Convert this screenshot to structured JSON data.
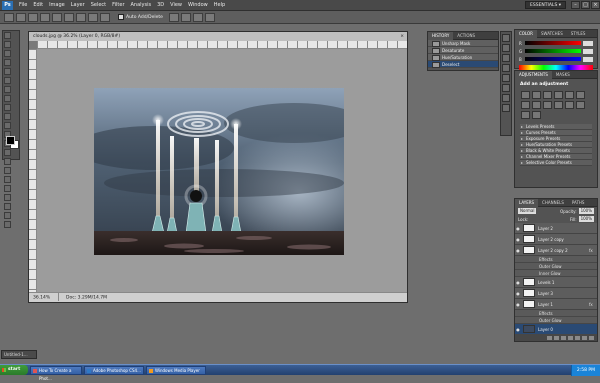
{
  "app": {
    "logo": "Ps",
    "menu": [
      "File",
      "Edit",
      "Image",
      "Layer",
      "Select",
      "Filter",
      "Analysis",
      "3D",
      "View",
      "Window",
      "Help"
    ],
    "workspace": "ESSENTIALS ▾",
    "window_buttons": [
      "–",
      "□",
      "×"
    ]
  },
  "options_bar": {
    "auto_add_delete": "Auto Add/Delete"
  },
  "document": {
    "title": "clouds.jpg @ 36.2% (Layer 0, RGB/8#)",
    "close": "×",
    "zoom": "36.14%",
    "doc_size": "Doc: 3.29M/14.7M"
  },
  "history": {
    "tabs": [
      "History",
      "Actions"
    ],
    "items": [
      "Unsharp Mask",
      "Desaturate",
      "Hue/Saturation",
      "Deselect"
    ]
  },
  "color_panel": {
    "tabs": [
      "Color",
      "Swatches",
      "Styles"
    ],
    "channels": [
      {
        "label": "R",
        "value": ""
      },
      {
        "label": "G",
        "value": ""
      },
      {
        "label": "B",
        "value": ""
      }
    ]
  },
  "adjustments": {
    "tabs": [
      "Adjustments",
      "Masks"
    ],
    "title": "Add an adjustment",
    "presets": [
      "Levels Presets",
      "Curves Presets",
      "Exposure Presets",
      "Hue/Saturation Presets",
      "Black & White Presets",
      "Channel Mixer Presets",
      "Selective Color Presets"
    ]
  },
  "layers": {
    "tabs": [
      "Layers",
      "Channels",
      "Paths"
    ],
    "blend_mode": "Normal",
    "opacity_label": "Opacity:",
    "opacity": "100%",
    "lock_label": "Lock:",
    "fill_label": "Fill:",
    "fill": "100%",
    "rows": [
      {
        "type": "layer",
        "name": "Layer 2",
        "fx": false,
        "selected": false
      },
      {
        "type": "layer",
        "name": "Layer 2 copy",
        "fx": false,
        "selected": false
      },
      {
        "type": "layer",
        "name": "Layer 2 copy 2",
        "fx": true,
        "selected": false
      },
      {
        "type": "sub",
        "name": "Effects"
      },
      {
        "type": "sub",
        "name": "Outer Glow"
      },
      {
        "type": "sub",
        "name": "Inner Glow"
      },
      {
        "type": "layer",
        "name": "Levels 1",
        "fx": false,
        "selected": false
      },
      {
        "type": "layer",
        "name": "Layer 3",
        "fx": false,
        "selected": false
      },
      {
        "type": "layer",
        "name": "Layer 1",
        "fx": true,
        "selected": false
      },
      {
        "type": "sub",
        "name": "Effects"
      },
      {
        "type": "sub",
        "name": "Outer Glow"
      },
      {
        "type": "layer",
        "name": "Layer 0",
        "fx": false,
        "selected": true
      }
    ]
  },
  "minimized_doc": "Untitled-1...",
  "taskbar": {
    "start": "start",
    "buttons": [
      {
        "label": "How To Create a Phot...",
        "kind": "browser"
      },
      {
        "label": "Adobe Photoshop CS4...",
        "kind": "ps"
      },
      {
        "label": "Windows Media Player",
        "kind": "wm"
      }
    ],
    "clock": "2:58 PM"
  },
  "colors": {
    "accent": "#2a4a74",
    "panel": "#535353",
    "workspace": "#6e6e6e"
  }
}
